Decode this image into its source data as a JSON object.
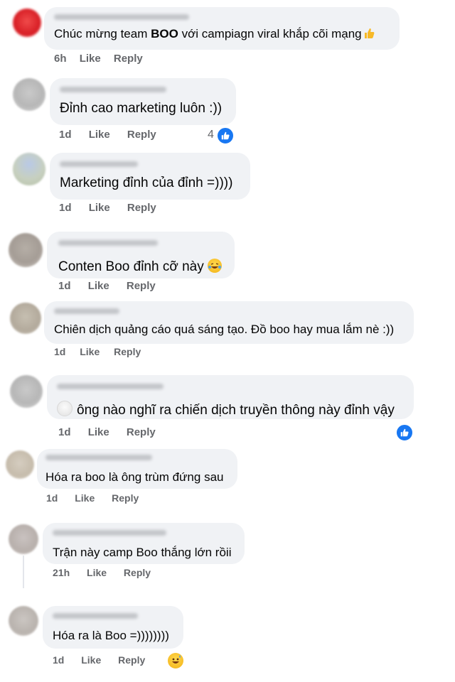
{
  "comments": [
    {
      "text_before": "Chúc mừng team ",
      "text_bold": "BOO",
      "text_after": " với campiagn viral khắp cõi mạng",
      "time": "6h",
      "like": "Like",
      "reply": "Reply"
    },
    {
      "text": "Đỉnh cao marketing luôn :))",
      "time": "1d",
      "like": "Like",
      "reply": "Reply",
      "reactions": "4"
    },
    {
      "text": "Marketing đỉnh của đỉnh =))))",
      "time": "1d",
      "like": "Like",
      "reply": "Reply"
    },
    {
      "text": "Conten Boo đỉnh cỡ này",
      "time": "1d",
      "like": "Like",
      "reply": "Reply"
    },
    {
      "text": "Chiên dịch quảng cáo quá sáng tạo. Đồ boo hay mua lắm nè :))",
      "time": "1d",
      "like": "Like",
      "reply": "Reply"
    },
    {
      "text": "ông nào nghĩ ra chiến dịch truyền thông này đỉnh vậy",
      "time": "1d",
      "like": "Like",
      "reply": "Reply"
    },
    {
      "text": "Hóa ra boo là ông trùm đứng sau",
      "time": "1d",
      "like": "Like",
      "reply": "Reply"
    },
    {
      "text": "Trận này camp Boo thắng lớn rồii",
      "time": "21h",
      "like": "Like",
      "reply": "Reply"
    },
    {
      "text": "Hóa ra là Boo =))))))))",
      "time": "1d",
      "like": "Like",
      "reply": "Reply"
    }
  ],
  "colors": {
    "bubble": "#f0f2f5",
    "meta": "#65676b",
    "like_blue": "#1877f2"
  }
}
